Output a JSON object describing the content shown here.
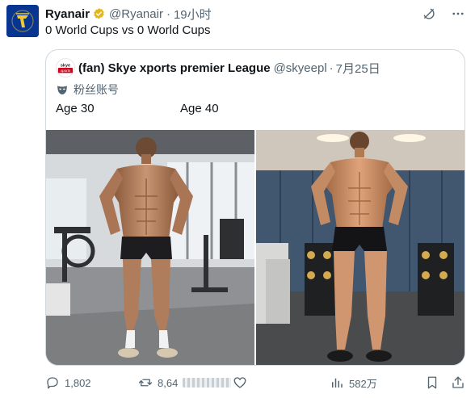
{
  "tweet": {
    "author_name": "Ryanair",
    "handle": "@Ryanair",
    "separator": "·",
    "time": "19小时",
    "text": "0 World Cups vs 0 World Cups",
    "brand_color": "#073590",
    "accent_color": "#f1c933"
  },
  "quote": {
    "avatar_text": "skye",
    "avatar_subtext": "xports",
    "author_name": "(fan) Skye xports premier League",
    "handle": "@skyeepl",
    "separator": "·",
    "time": "7月25日",
    "label": "粉丝账号",
    "text_left": "Age 30",
    "text_right": "Age 40",
    "images": [
      {
        "icon": "gym-photo-icon",
        "scene": "shirtless athlete in a gym with windows"
      },
      {
        "icon": "gym-photo-icon",
        "scene": "shirtless athlete in a gym with dumbbell rack"
      }
    ]
  },
  "actions": {
    "replies": "1,802",
    "reposts": "8,64",
    "views": "582万"
  },
  "icons": {
    "verified": "verified-badge-icon",
    "grok": "grok-icon",
    "more": "more-icon",
    "reply": "reply-icon",
    "repost": "repost-icon",
    "like": "like-icon",
    "views": "views-icon",
    "bookmark": "bookmark-icon",
    "share": "share-icon"
  }
}
